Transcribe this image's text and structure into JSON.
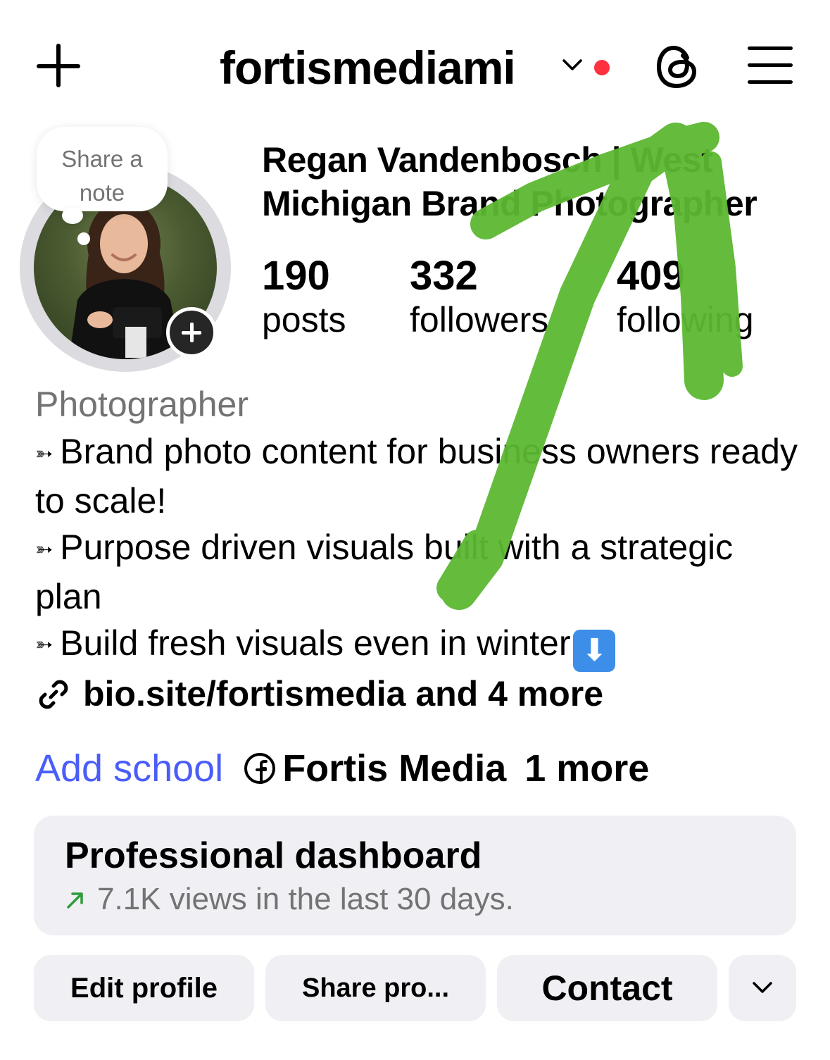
{
  "header": {
    "username": "fortismediami"
  },
  "avatar": {
    "note_text": "Share a note"
  },
  "profile": {
    "full_name": "Regan Vandenbosch | West Michigan Brand Photographer",
    "stats": [
      {
        "value": "190",
        "label": "posts"
      },
      {
        "value": "332",
        "label": "followers"
      },
      {
        "value": "409",
        "label": "following"
      }
    ]
  },
  "bio": {
    "category": "Photographer",
    "lines": [
      "Brand photo content for business owners ready to scale!",
      "Purpose driven visuals built with a strategic plan",
      "Build fresh visuals even in winter"
    ],
    "bullet": "➳",
    "emoji": "⬇",
    "link_text": "bio.site/fortismedia and 4 more"
  },
  "meta_row": {
    "add_school": "Add school",
    "facebook_name": "Fortis Media",
    "more": "1 more"
  },
  "dashboard": {
    "title": "Professional dashboard",
    "subtitle": "7.1K views in the last 30 days."
  },
  "actions": {
    "edit": "Edit profile",
    "share": "Share pro...",
    "contact": "Contact"
  },
  "colors": {
    "link_blue": "#4a5df9",
    "notification_red": "#ff3040",
    "annotation_green": "#5cb832",
    "button_bg": "#efeff4"
  }
}
